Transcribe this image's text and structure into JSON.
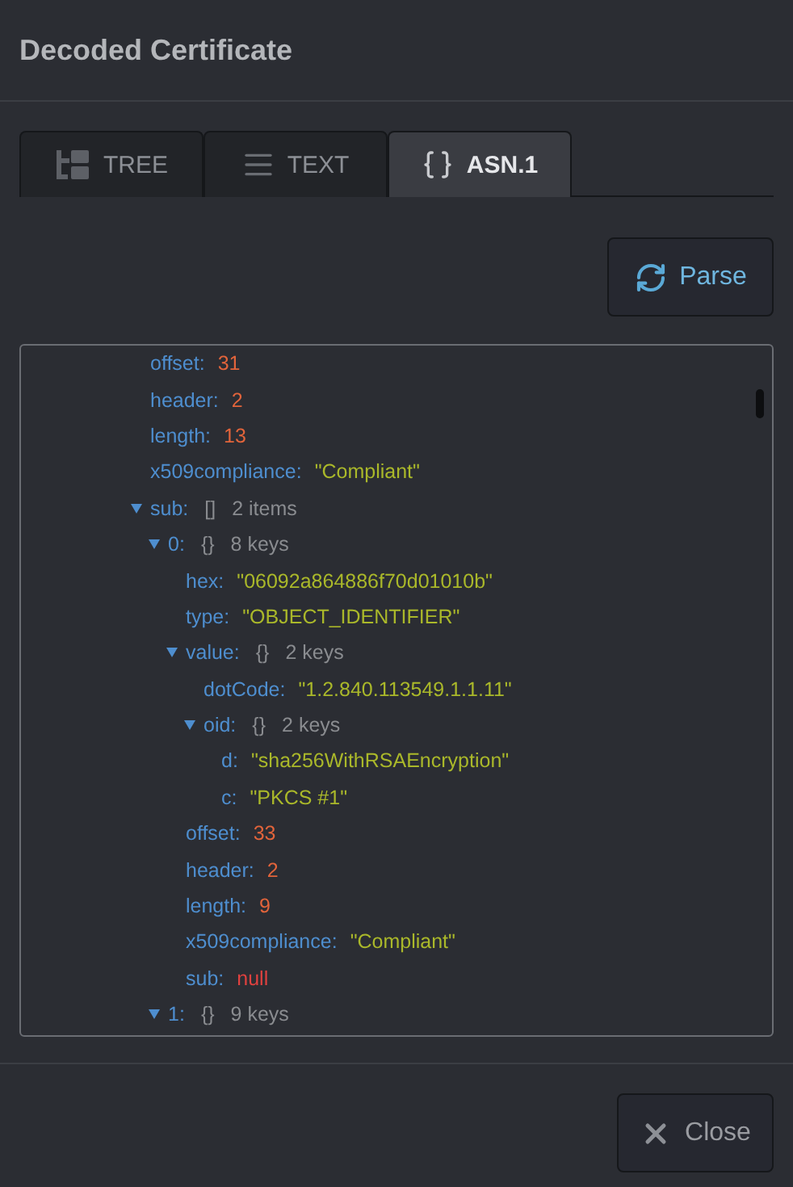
{
  "dialog": {
    "title": "Decoded Certificate"
  },
  "tabs": [
    {
      "label": "TREE",
      "kind": "tree",
      "selected": false
    },
    {
      "label": "TEXT",
      "kind": "text",
      "selected": false
    },
    {
      "label": "ASN.1",
      "kind": "braces",
      "selected": true
    }
  ],
  "parse_button": {
    "label": "Parse"
  },
  "tree": {
    "nodes": [
      {
        "key": "offset:",
        "kind": "number",
        "value": "31"
      },
      {
        "key": "header:",
        "kind": "number",
        "value": "2"
      },
      {
        "key": "length:",
        "kind": "number",
        "value": "13"
      },
      {
        "key": "x509compliance:",
        "kind": "string",
        "value": "\"Compliant\""
      },
      {
        "key": "sub:",
        "kind": "group",
        "brackets": "[]",
        "count": "2 items",
        "expanded": true,
        "children": [
          {
            "key": "0:",
            "kind": "group",
            "brackets": "{}",
            "count": "8 keys",
            "expanded": true,
            "children": [
              {
                "key": "hex:",
                "kind": "string",
                "value": "\"06092a864886f70d01010b\""
              },
              {
                "key": "type:",
                "kind": "string",
                "value": "\"OBJECT_IDENTIFIER\""
              },
              {
                "key": "value:",
                "kind": "group",
                "brackets": "{}",
                "count": "2 keys",
                "expanded": true,
                "children": [
                  {
                    "key": "dotCode:",
                    "kind": "string",
                    "value": "\"1.2.840.113549.1.1.11\""
                  },
                  {
                    "key": "oid:",
                    "kind": "group",
                    "brackets": "{}",
                    "count": "2 keys",
                    "expanded": true,
                    "children": [
                      {
                        "key": "d:",
                        "kind": "string",
                        "value": "\"sha256WithRSAEncryption\""
                      },
                      {
                        "key": "c:",
                        "kind": "string",
                        "value": "\"PKCS #1\""
                      }
                    ]
                  }
                ]
              },
              {
                "key": "offset:",
                "kind": "number",
                "value": "33"
              },
              {
                "key": "header:",
                "kind": "number",
                "value": "2"
              },
              {
                "key": "length:",
                "kind": "number",
                "value": "9"
              },
              {
                "key": "x509compliance:",
                "kind": "string",
                "value": "\"Compliant\""
              },
              {
                "key": "sub:",
                "kind": "null",
                "value": "null"
              }
            ]
          },
          {
            "key": "1:",
            "kind": "group",
            "brackets": "{}",
            "count": "9 keys",
            "expanded": true
          }
        ]
      }
    ]
  },
  "close_button": {
    "label": "Close"
  }
}
